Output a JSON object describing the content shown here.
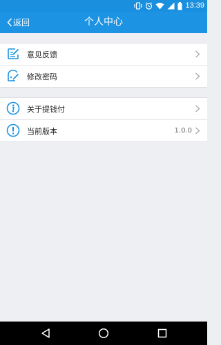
{
  "status_bar": {
    "time": "13:39",
    "icons": [
      "vibrate-icon",
      "alarm-icon",
      "wifi-icon",
      "signal-icon",
      "battery-icon"
    ]
  },
  "header": {
    "back_label": "返回",
    "title": "个人中心"
  },
  "group_1": {
    "items": [
      {
        "label": "意见反馈",
        "icon": "feedback-edit-icon"
      },
      {
        "label": "修改密码",
        "icon": "password-edit-icon"
      }
    ]
  },
  "group_2": {
    "items": [
      {
        "label": "关于提钱付",
        "icon": "info-icon"
      },
      {
        "label": "当前版本",
        "icon": "exclamation-icon",
        "value": "1.0.0"
      }
    ]
  },
  "colors": {
    "accent": "#1c93e3",
    "icon_blue": "#1c93e3",
    "background": "#eeeff3"
  },
  "nav": {
    "buttons": [
      "back-triangle-icon",
      "home-circle-icon",
      "recents-square-icon"
    ]
  }
}
